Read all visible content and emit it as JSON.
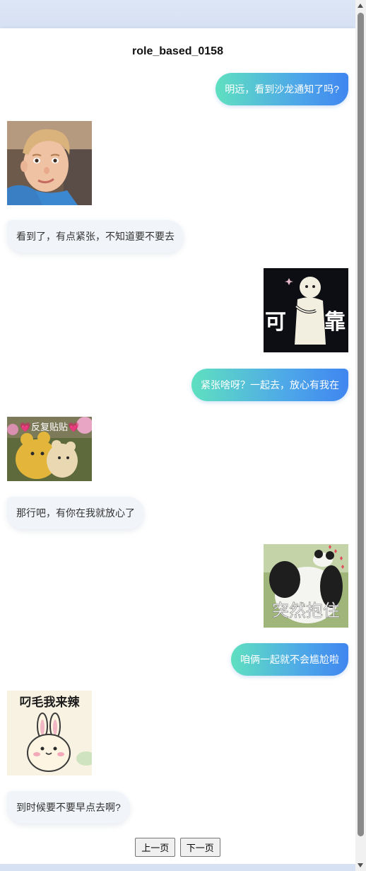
{
  "conversation": {
    "title": "role_based_0158",
    "messages": [
      {
        "side": "me",
        "text": "明远，看到沙龙通知了吗?"
      },
      {
        "side": "them",
        "sticker": "boy-face"
      },
      {
        "side": "them",
        "text": "看到了，有点紧张，不知道要不要去"
      },
      {
        "side": "me",
        "sticker": "reliable-figure",
        "sticker_text": [
          "可",
          "靠"
        ]
      },
      {
        "side": "me",
        "text": "紧张啥呀？一起去，放心有我在"
      },
      {
        "side": "them",
        "sticker": "hugging-bears",
        "sticker_text": "💗反复贴贴💗"
      },
      {
        "side": "them",
        "text": "那行吧，有你在我就放心了"
      },
      {
        "side": "me",
        "sticker": "panda-hug",
        "sticker_text": "突然抱住"
      },
      {
        "side": "me",
        "text": "咱俩一起就不会尴尬啦"
      },
      {
        "side": "them",
        "sticker": "bunny",
        "sticker_text": "叼毛我来辣"
      },
      {
        "side": "them",
        "text": "到时候要不要早点去啊?"
      }
    ]
  },
  "pagination": {
    "prev_label": "上一页",
    "next_label": "下一页"
  },
  "colors": {
    "outgoing_gradient_start": "#5fe0c0",
    "outgoing_gradient_end": "#3f86f0",
    "incoming_bg": "#f1f4f9",
    "page_bg": "#dfe8f6"
  },
  "icons": {
    "scroll_up": "scroll-up-arrow-icon",
    "scroll_down": "scroll-down-arrow-icon"
  }
}
